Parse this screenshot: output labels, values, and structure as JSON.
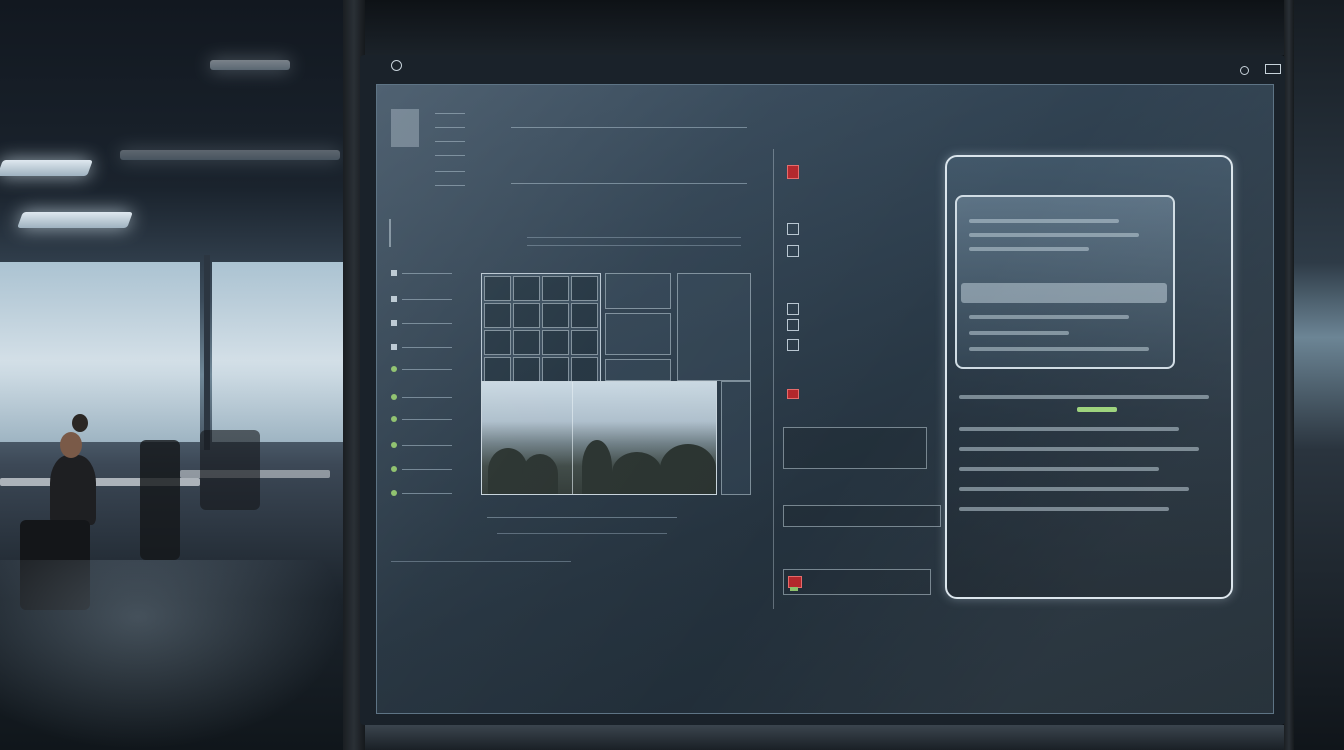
{
  "colors": {
    "accent_green": "#8cc06a",
    "accent_red": "#b3262b",
    "screen_text": "#c5d3dd"
  },
  "sidebar": {
    "items": [
      {
        "icon": "status-dot-icon"
      },
      {
        "icon": "status-dot-icon"
      },
      {
        "icon": "status-dot-icon"
      },
      {
        "icon": "status-dot-icon"
      },
      {
        "icon": "status-dot-icon"
      },
      {
        "icon": "status-dot-icon"
      }
    ]
  },
  "media": {
    "icon": "image-icon"
  },
  "middle_list": {
    "items": [
      {
        "icon": "alert-icon"
      },
      {
        "icon": "file-icon"
      },
      {
        "icon": "file-icon"
      },
      {
        "icon": "file-icon"
      },
      {
        "icon": "file-icon"
      },
      {
        "icon": "file-icon"
      }
    ]
  },
  "bezel": {
    "power_icon": "power-icon",
    "settings_icon": "settings-icon"
  }
}
